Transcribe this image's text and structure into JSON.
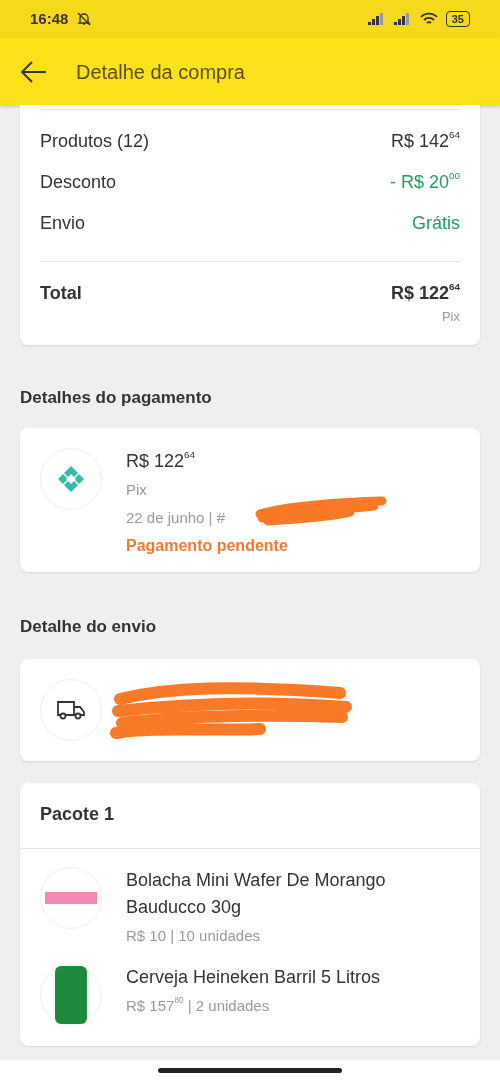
{
  "status_bar": {
    "time": "16:48",
    "battery": "35"
  },
  "header": {
    "title": "Detalhe da compra"
  },
  "summary": {
    "rows": [
      {
        "label": "Produtos (12)",
        "value": "R$ 142$^{64}$",
        "kind": "plain"
      },
      {
        "label": "Desconto",
        "value": "- R$ 20$^{00}$",
        "kind": "positive"
      },
      {
        "label": "Envio",
        "value": "Grátis",
        "kind": "positive"
      }
    ],
    "total": {
      "label": "Total",
      "value": "R$ 122$^{64}$",
      "method": "Pix"
    }
  },
  "payment": {
    "heading": "Detalhes do pagamento",
    "amount": "R$ 122$^{64}$",
    "method": "Pix",
    "reference": "22 de junho | #",
    "status": "Pagamento pendente"
  },
  "shipping": {
    "heading": "Detalhe do envio"
  },
  "package": {
    "title": "Pacote 1",
    "items": [
      {
        "name": "Bolacha Mini Wafer De Morango Bauducco 30g",
        "detail": "R$ 10 | 10 unidades"
      },
      {
        "name": "Cerveja Heineken Barril 5 Litros",
        "detail": "R$ 157$^{80}$ | 2 unidades"
      }
    ]
  }
}
